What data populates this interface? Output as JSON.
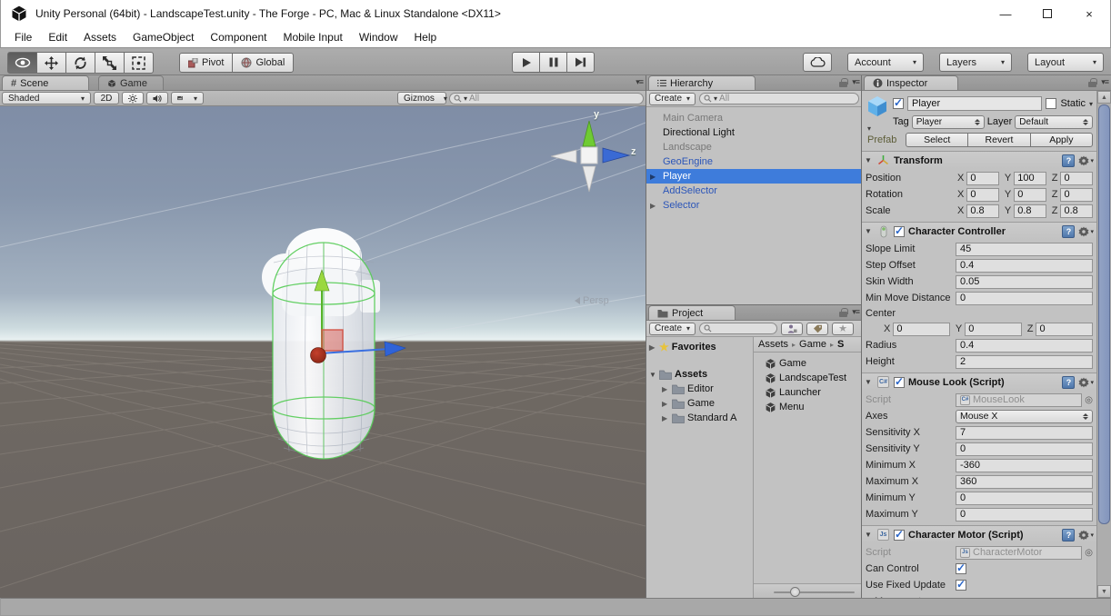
{
  "colors": {
    "selection_blue": "#3E7CDB",
    "prefab_text_blue": "#2B55B8",
    "scroll_thumb_blue": "#8A9BC0",
    "sky_top": "#7F8DA6",
    "ground": "#6D6762"
  },
  "window": {
    "title": "Unity Personal (64bit) - LandscapeTest.unity - The Forge - PC, Mac & Linux Standalone <DX11>"
  },
  "menu": {
    "file": "File",
    "edit": "Edit",
    "assets": "Assets",
    "gameobject": "GameObject",
    "component": "Component",
    "mobile_input": "Mobile Input",
    "window": "Window",
    "help": "Help"
  },
  "toolbar": {
    "pivot": "Pivot",
    "global": "Global",
    "account": "Account",
    "layers": "Layers",
    "layout": "Layout"
  },
  "scene": {
    "tab_scene": "Scene",
    "tab_game": "Game",
    "shaded": "Shaded",
    "mode_2d": "2D",
    "gizmos": "Gizmos",
    "search_placeholder": "All",
    "axis_y": "y",
    "axis_z": "z",
    "persp": "Persp"
  },
  "hierarchy": {
    "tab": "Hierarchy",
    "create": "Create",
    "search_placeholder": "All",
    "items": [
      {
        "label": "Main Camera"
      },
      {
        "label": "Directional Light"
      },
      {
        "label": "Landscape"
      },
      {
        "label": "GeoEngine"
      },
      {
        "label": "Player"
      },
      {
        "label": "AddSelector"
      },
      {
        "label": "Selector"
      }
    ]
  },
  "project": {
    "tab": "Project",
    "create": "Create",
    "favorites": "Favorites",
    "tree": {
      "assets": "Assets",
      "editor": "Editor",
      "game": "Game",
      "standard": "Standard A"
    },
    "breadcrumb": {
      "a": "Assets",
      "b": "Game",
      "c": "S"
    },
    "files": [
      {
        "label": "Game"
      },
      {
        "label": "LandscapeTest"
      },
      {
        "label": "Launcher"
      },
      {
        "label": "Menu"
      }
    ]
  },
  "inspector": {
    "tab": "Inspector",
    "name": "Player",
    "static": "Static",
    "tag_label": "Tag",
    "tag": "Player",
    "layer_label": "Layer",
    "layer": "Default",
    "prefab_label": "Prefab",
    "select": "Select",
    "revert": "Revert",
    "apply": "Apply",
    "transform": {
      "title": "Transform",
      "position_label": "Position",
      "rotation_label": "Rotation",
      "scale_label": "Scale",
      "x": "X",
      "y": "Y",
      "z": "Z",
      "position": {
        "x": "0",
        "y": "100",
        "z": "0"
      },
      "rotation": {
        "x": "0",
        "y": "0",
        "z": "0"
      },
      "scale": {
        "x": "0.8",
        "y": "0.8",
        "z": "0.8"
      }
    },
    "character_controller": {
      "title": "Character Controller",
      "slope_limit_label": "Slope Limit",
      "slope_limit": "45",
      "step_offset_label": "Step Offset",
      "step_offset": "0.4",
      "skin_width_label": "Skin Width",
      "skin_width": "0.05",
      "min_move_label": "Min Move Distance",
      "min_move": "0",
      "center_label": "Center",
      "center": {
        "x": "0",
        "y": "0",
        "z": "0"
      },
      "radius_label": "Radius",
      "radius": "0.4",
      "height_label": "Height",
      "height": "2"
    },
    "mouse_look": {
      "title": "Mouse Look (Script)",
      "script_label": "Script",
      "script": "MouseLook",
      "axes_label": "Axes",
      "axes": "Mouse X",
      "sensitivity_x_label": "Sensitivity X",
      "sensitivity_x": "7",
      "sensitivity_y_label": "Sensitivity Y",
      "sensitivity_y": "0",
      "minimum_x_label": "Minimum X",
      "minimum_x": "-360",
      "maximum_x_label": "Maximum X",
      "maximum_x": "360",
      "minimum_y_label": "Minimum Y",
      "minimum_y": "0",
      "maximum_y_label": "Maximum Y",
      "maximum_y": "0"
    },
    "character_motor": {
      "title": "Character Motor (Script)",
      "script_label": "Script",
      "script": "CharacterMotor",
      "can_control_label": "Can Control",
      "use_fixed_update_label": "Use Fixed Update",
      "movement_label": "Movement"
    }
  }
}
